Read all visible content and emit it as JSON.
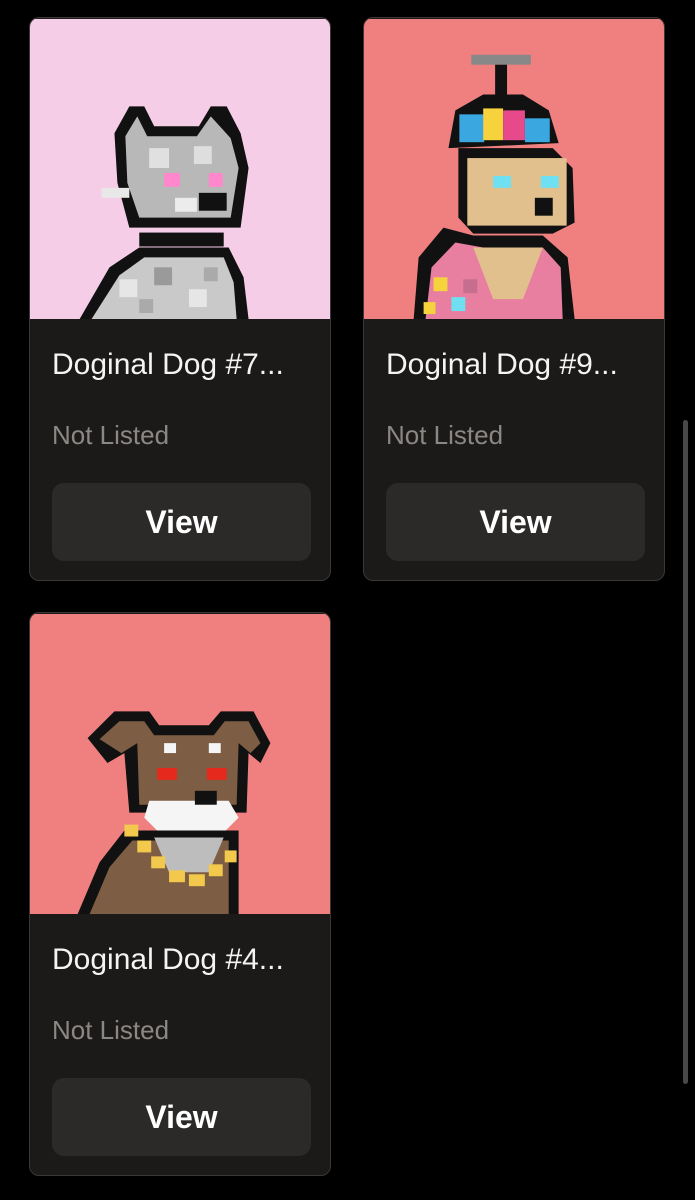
{
  "cards": [
    {
      "title": "Doginal Dog #7...",
      "status": "Not Listed",
      "button_label": "View",
      "image_icon": "white-pixel-dog-icon",
      "background": "#f5cde6"
    },
    {
      "title": "Doginal Dog #9...",
      "status": "Not Listed",
      "button_label": "View",
      "image_icon": "propeller-hat-pixel-dog-icon",
      "background": "#f08080"
    },
    {
      "title": "Doginal Dog #4...",
      "status": "Not Listed",
      "button_label": "View",
      "image_icon": "brown-pixel-dog-icon",
      "background": "#f08080"
    }
  ],
  "colors": {
    "card_bg": "#1c1a19",
    "button_bg": "#2c2a28",
    "muted_text": "#8b8784"
  }
}
